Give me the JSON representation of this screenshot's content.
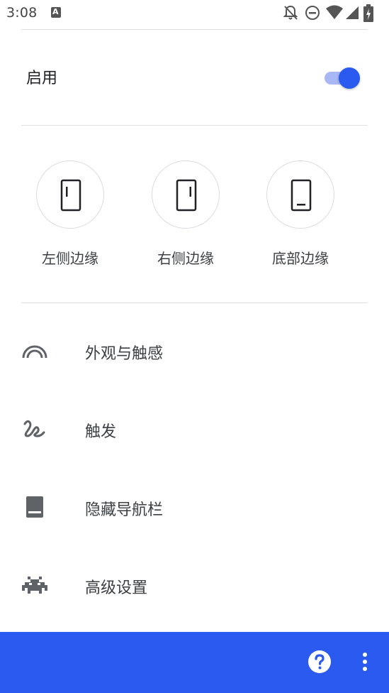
{
  "status_bar": {
    "time": "3:08",
    "icons": [
      "keyboard-a-icon",
      "notifications-off-icon",
      "do-not-disturb-icon",
      "wifi-icon",
      "signal-icon",
      "battery-charging-icon"
    ]
  },
  "enable": {
    "label": "启用",
    "on": true
  },
  "edges": [
    {
      "label": "左侧边缘",
      "icon": "left-edge-phone-icon"
    },
    {
      "label": "右侧边缘",
      "icon": "right-edge-phone-icon"
    },
    {
      "label": "底部边缘",
      "icon": "bottom-edge-phone-icon"
    }
  ],
  "menu": [
    {
      "label": "外观与触感",
      "icon": "rainbow-arc-icon"
    },
    {
      "label": "触发",
      "icon": "gesture-icon"
    },
    {
      "label": "隐藏导航栏",
      "icon": "phone-navbar-icon"
    },
    {
      "label": "高级设置",
      "icon": "space-invader-icon"
    }
  ],
  "bottom_bar": {
    "help_icon": "help-icon",
    "more_icon": "more-vert-icon"
  },
  "colors": {
    "accent": "#2a5aef",
    "toggle_track": "#a8b7f5",
    "divider": "#e0e0e0",
    "icon_gray": "#5f6368"
  }
}
